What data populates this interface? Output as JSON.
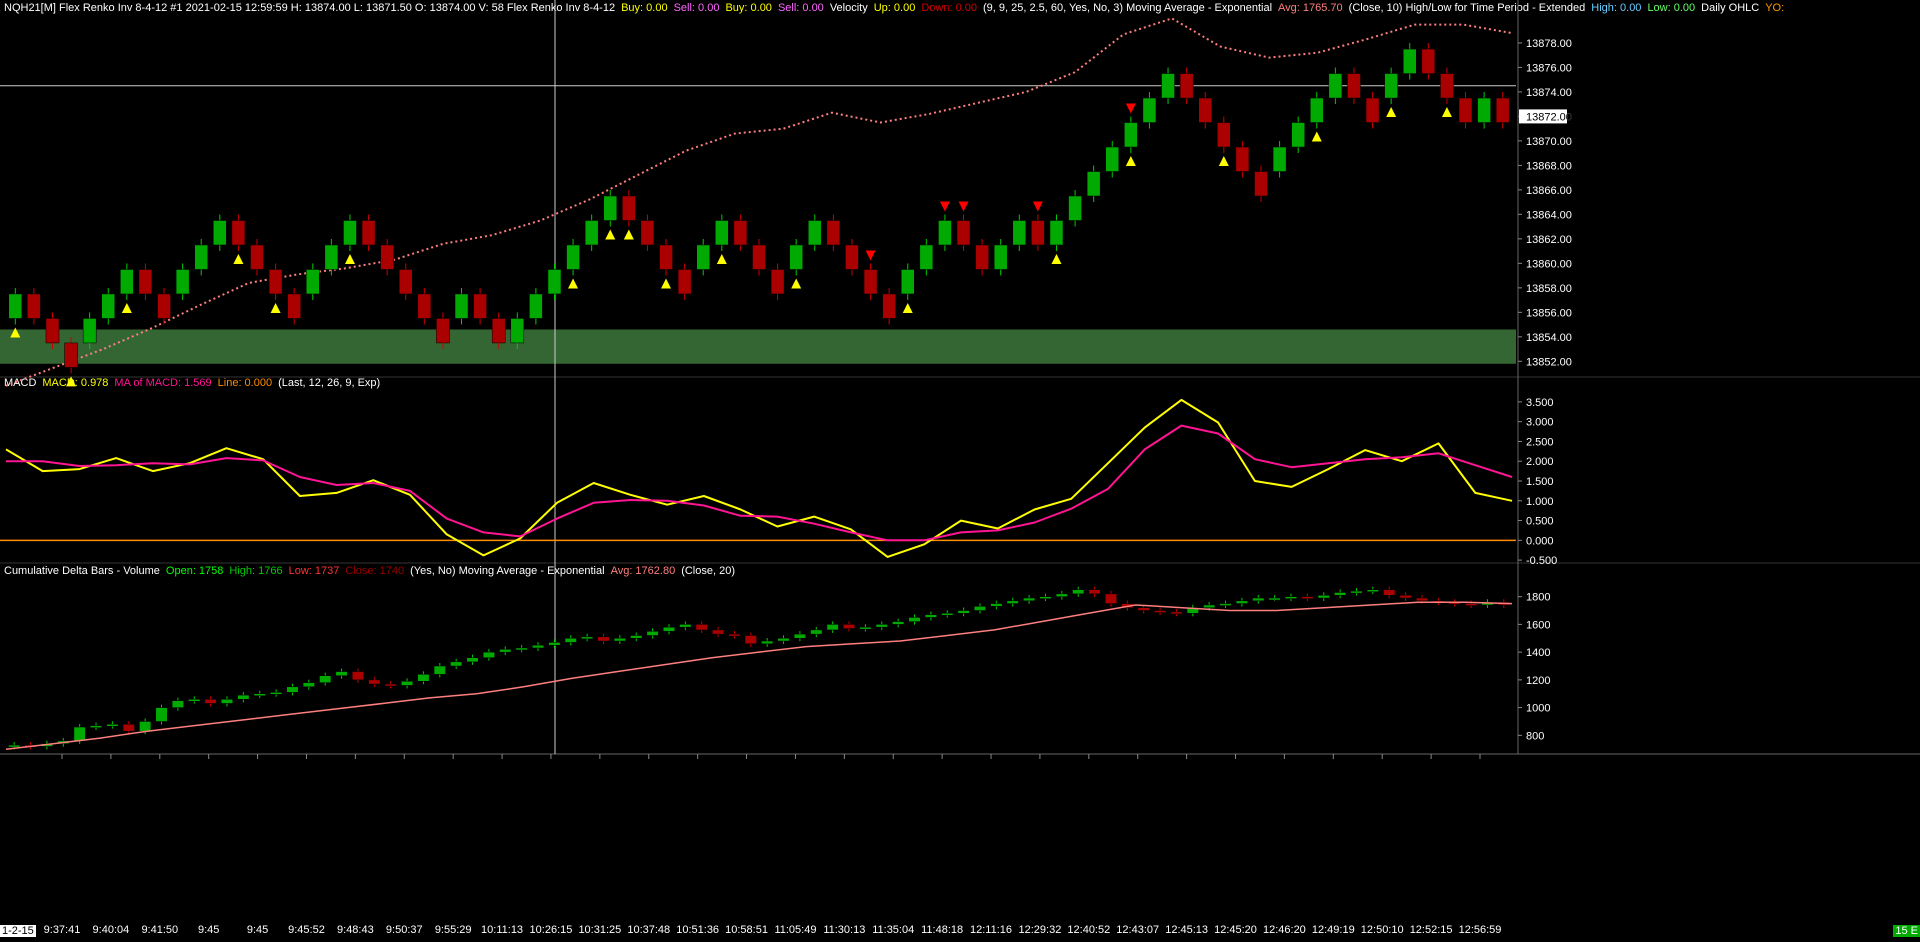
{
  "price_pane": {
    "header": [
      {
        "text": "NQH21[M]  Flex Renko Inv 8-4-12  #1 2021-02-15 12:59:59 H: 13874.00 L: 13871.50 O: 13874.00 V: 58 Flex Renko Inv 8-4-12",
        "color": "#ffffff"
      },
      {
        "text": "Buy: 0.00",
        "color": "#ffff00"
      },
      {
        "text": "Sell: 0.00",
        "color": "#ff66ff"
      },
      {
        "text": "Buy: 0.00",
        "color": "#ffff00"
      },
      {
        "text": "Sell: 0.00",
        "color": "#ff66ff"
      },
      {
        "text": "Velocity",
        "color": "#ffffff"
      },
      {
        "text": "Up: 0.00",
        "color": "#ffff00"
      },
      {
        "text": "Down: 0.00",
        "color": "#cc0000"
      },
      {
        "text": "(9, 9, 25, 2.5, 60, Yes, No, 3)  Moving Average - Exponential",
        "color": "#ffffff"
      },
      {
        "text": "Avg: 1765.70",
        "color": "#ff7f7f"
      },
      {
        "text": "(Close, 10)  High/Low for Time Period - Extended",
        "color": "#ffffff"
      },
      {
        "text": "High: 0.00",
        "color": "#66ccff"
      },
      {
        "text": "Low: 0.00",
        "color": "#66ff66"
      },
      {
        "text": "Daily OHLC",
        "color": "#ffffff"
      },
      {
        "text": "YO:",
        "color": "#ff9900"
      }
    ],
    "y_ticks": [
      "13878.00",
      "13876.00",
      "13874.00",
      "13872.00",
      "13870.00",
      "13868.00",
      "13866.00",
      "13864.00",
      "13862.00",
      "13860.00",
      "13858.00",
      "13856.00",
      "13854.00",
      "13852.00"
    ],
    "current_price": "13872.00"
  },
  "macd_pane": {
    "header": [
      {
        "text": "MACD",
        "color": "#ffffff"
      },
      {
        "text": "MACD: 0.978",
        "color": "#ffff00"
      },
      {
        "text": "MA of MACD: 1.569",
        "color": "#ff1493"
      },
      {
        "text": "Line: 0.000",
        "color": "#ff8c00"
      },
      {
        "text": "(Last, 12, 26, 9, Exp)",
        "color": "#ffffff"
      }
    ],
    "y_ticks": [
      "3.500",
      "3.000",
      "2.500",
      "2.000",
      "1.500",
      "1.000",
      "0.500",
      "0.000",
      "-0.500"
    ]
  },
  "delta_pane": {
    "header": [
      {
        "text": "Cumulative Delta Bars - Volume",
        "color": "#ffffff"
      },
      {
        "text": "Open: 1758",
        "color": "#00ff00"
      },
      {
        "text": "High: 1766",
        "color": "#00cc00"
      },
      {
        "text": "Low: 1737",
        "color": "#ff3333"
      },
      {
        "text": "Close: 1740",
        "color": "#990000"
      },
      {
        "text": "(Yes, No)  Moving Average - Exponential",
        "color": "#ffffff"
      },
      {
        "text": "Avg: 1762.80",
        "color": "#ff7f7f"
      },
      {
        "text": "(Close, 20)",
        "color": "#ffffff"
      }
    ],
    "y_ticks": [
      "1800",
      "1600",
      "1400",
      "1200",
      "1000",
      "800"
    ]
  },
  "x_ticks": [
    "9:37:41",
    "9:40:04",
    "9:41:50",
    "9:45",
    "9:45",
    "9:45:52",
    "9:48:43",
    "9:50:37",
    "9:55:29",
    "10:11:13",
    "10:26:15",
    "10:31:25",
    "10:37:48",
    "10:51:36",
    "10:58:51",
    "11:05:49",
    "11:30:13",
    "11:35:04",
    "11:48:18",
    "12:11:16",
    "12:29:32",
    "12:40:52",
    "12:43:07",
    "12:45:13",
    "12:45:20",
    "12:46:20",
    "12:49:19",
    "12:50:10",
    "12:52:15",
    "12:56:59"
  ],
  "corner_left": "1-2-15",
  "corner_right": "15 E",
  "colors": {
    "up": "#00cc00",
    "down": "#cc0000",
    "support_zone": "#336633",
    "ema": "#ff7f7f",
    "macd": "#ffff00",
    "signal": "#ff1493",
    "zero": "#ff8c00"
  },
  "chart_data": [
    {
      "type": "candlestick",
      "title": "NQH21[M] Flex Renko Inv 8-4-12",
      "ylim": [
        13850.8,
        13880.2
      ],
      "bricks": [
        [
          13855.5,
          13857.5
        ],
        [
          13857.5,
          13855.5
        ],
        [
          13855.5,
          13853.5
        ],
        [
          13853.5,
          13851.5
        ],
        [
          13853.5,
          13855.5
        ],
        [
          13855.5,
          13857.5
        ],
        [
          13857.5,
          13859.5
        ],
        [
          13859.5,
          13857.5
        ],
        [
          13857.5,
          13855.5
        ],
        [
          13857.5,
          13859.5
        ],
        [
          13859.5,
          13861.5
        ],
        [
          13861.5,
          13863.5
        ],
        [
          13863.5,
          13861.5
        ],
        [
          13861.5,
          13859.5
        ],
        [
          13859.5,
          13857.5
        ],
        [
          13857.5,
          13855.5
        ],
        [
          13857.5,
          13859.5
        ],
        [
          13859.5,
          13861.5
        ],
        [
          13861.5,
          13863.5
        ],
        [
          13863.5,
          13861.5
        ],
        [
          13861.5,
          13859.5
        ],
        [
          13859.5,
          13857.5
        ],
        [
          13857.5,
          13855.5
        ],
        [
          13855.5,
          13853.5
        ],
        [
          13855.5,
          13857.5
        ],
        [
          13857.5,
          13855.5
        ],
        [
          13855.5,
          13853.5
        ],
        [
          13853.5,
          13855.5
        ],
        [
          13855.5,
          13857.5
        ],
        [
          13857.5,
          13859.5
        ],
        [
          13859.5,
          13861.5
        ],
        [
          13861.5,
          13863.5
        ],
        [
          13863.5,
          13865.5
        ],
        [
          13865.5,
          13863.5
        ],
        [
          13863.5,
          13861.5
        ],
        [
          13861.5,
          13859.5
        ],
        [
          13859.5,
          13857.5
        ],
        [
          13859.5,
          13861.5
        ],
        [
          13861.5,
          13863.5
        ],
        [
          13863.5,
          13861.5
        ],
        [
          13861.5,
          13859.5
        ],
        [
          13859.5,
          13857.5
        ],
        [
          13859.5,
          13861.5
        ],
        [
          13861.5,
          13863.5
        ],
        [
          13863.5,
          13861.5
        ],
        [
          13861.5,
          13859.5
        ],
        [
          13859.5,
          13857.5
        ],
        [
          13857.5,
          13855.5
        ],
        [
          13857.5,
          13859.5
        ],
        [
          13859.5,
          13861.5
        ],
        [
          13861.5,
          13863.5
        ],
        [
          13863.5,
          13861.5
        ],
        [
          13861.5,
          13859.5
        ],
        [
          13859.5,
          13861.5
        ],
        [
          13861.5,
          13863.5
        ],
        [
          13863.5,
          13861.5
        ],
        [
          13861.5,
          13863.5
        ],
        [
          13863.5,
          13865.5
        ],
        [
          13865.5,
          13867.5
        ],
        [
          13867.5,
          13869.5
        ],
        [
          13869.5,
          13871.5
        ],
        [
          13871.5,
          13873.5
        ],
        [
          13873.5,
          13875.5
        ],
        [
          13875.5,
          13873.5
        ],
        [
          13873.5,
          13871.5
        ],
        [
          13871.5,
          13869.5
        ],
        [
          13869.5,
          13867.5
        ],
        [
          13867.5,
          13865.5
        ],
        [
          13867.5,
          13869.5
        ],
        [
          13869.5,
          13871.5
        ],
        [
          13871.5,
          13873.5
        ],
        [
          13873.5,
          13875.5
        ],
        [
          13875.5,
          13873.5
        ],
        [
          13873.5,
          13871.5
        ],
        [
          13873.5,
          13875.5
        ],
        [
          13875.5,
          13877.5
        ],
        [
          13877.5,
          13875.5
        ],
        [
          13875.5,
          13873.5
        ],
        [
          13873.5,
          13871.5
        ],
        [
          13871.5,
          13873.5
        ],
        [
          13873.5,
          13871.5
        ]
      ],
      "ema": [
        13850.0,
        13851.5,
        13853.0,
        13854.7,
        13856.6,
        13858.4,
        13859.1,
        13859.6,
        13860.3,
        13861.6,
        13862.3,
        13863.5,
        13865.2,
        13867.2,
        13869.2,
        13870.6,
        13871.0,
        13872.3,
        13871.5,
        13872.2,
        13873.1,
        13874.0,
        13875.6,
        13878.7,
        13880.0,
        13877.7,
        13876.8,
        13877.2,
        13878.3,
        13879.5,
        13879.5,
        13878.8
      ],
      "support_zone": [
        13851.8,
        13854.6
      ],
      "crosshair_price": 13874.5,
      "buy_signals": [
        0,
        3,
        6,
        12,
        14,
        18,
        30,
        32,
        33,
        35,
        38,
        42,
        48,
        56,
        60,
        65,
        70,
        74,
        77,
        83,
        85,
        87,
        89,
        90,
        91,
        92,
        95,
        96,
        101,
        106,
        110,
        114
      ],
      "sell_signals": [
        46,
        50,
        51,
        55,
        60,
        95,
        97,
        99,
        101
      ]
    },
    {
      "type": "line",
      "title": "MACD",
      "ylim": [
        -0.75,
        3.75
      ],
      "series": [
        {
          "name": "MACD",
          "values": [
            2.3,
            1.75,
            1.8,
            2.08,
            1.75,
            1.95,
            2.33,
            2.05,
            1.12,
            1.2,
            1.52,
            1.15,
            0.15,
            -0.38,
            0.05,
            0.95,
            1.45,
            1.15,
            0.9,
            1.12,
            0.78,
            0.35,
            0.6,
            0.28,
            -0.42,
            -0.1,
            0.5,
            0.3,
            0.78,
            1.05,
            1.95,
            2.85,
            3.55,
            2.98,
            1.5,
            1.35,
            1.8,
            2.28,
            2.0,
            2.45,
            1.2,
            1.0
          ]
        },
        {
          "name": "MA of MACD",
          "values": [
            2.0,
            2.0,
            1.88,
            1.9,
            1.95,
            1.92,
            2.08,
            2.02,
            1.6,
            1.4,
            1.45,
            1.25,
            0.55,
            0.2,
            0.1,
            0.55,
            0.95,
            1.02,
            1.0,
            0.88,
            0.62,
            0.6,
            0.42,
            0.2,
            0.0,
            0.0,
            0.2,
            0.25,
            0.45,
            0.8,
            1.3,
            2.3,
            2.9,
            2.7,
            2.05,
            1.85,
            1.95,
            2.05,
            2.1,
            2.2,
            1.9,
            1.6
          ]
        },
        {
          "name": "Line",
          "values": [
            0.0,
            0.0
          ]
        }
      ]
    },
    {
      "type": "candlestick",
      "title": "Cumulative Delta Bars - Volume",
      "ylim": [
        680,
        1920
      ],
      "avg": [
        700,
        740,
        780,
        830,
        870,
        910,
        950,
        990,
        1030,
        1070,
        1100,
        1150,
        1210,
        1260,
        1310,
        1360,
        1400,
        1440,
        1460,
        1480,
        1520,
        1560,
        1620,
        1680,
        1740,
        1720,
        1700,
        1700,
        1720,
        1740,
        1760,
        1760,
        1750
      ],
      "cumdelta": [
        730,
        720,
        740,
        760,
        860,
        870,
        880,
        830,
        900,
        1000,
        1050,
        1060,
        1030,
        1060,
        1090,
        1100,
        1110,
        1150,
        1180,
        1230,
        1260,
        1200,
        1170,
        1160,
        1190,
        1240,
        1300,
        1330,
        1360,
        1400,
        1420,
        1430,
        1450,
        1470,
        1500,
        1510,
        1480,
        1500,
        1520,
        1550,
        1580,
        1600,
        1560,
        1530,
        1520,
        1460,
        1480,
        1500,
        1530,
        1560,
        1600,
        1570,
        1580,
        1600,
        1620,
        1650,
        1670,
        1680,
        1700,
        1730,
        1750,
        1770,
        1790,
        1800,
        1820,
        1850,
        1820,
        1750,
        1720,
        1700,
        1690,
        1680,
        1720,
        1740,
        1750,
        1770,
        1790,
        1790,
        1800,
        1790,
        1810,
        1830,
        1840,
        1850,
        1810,
        1790,
        1770,
        1760,
        1750,
        1740,
        1760,
        1740
      ]
    }
  ]
}
